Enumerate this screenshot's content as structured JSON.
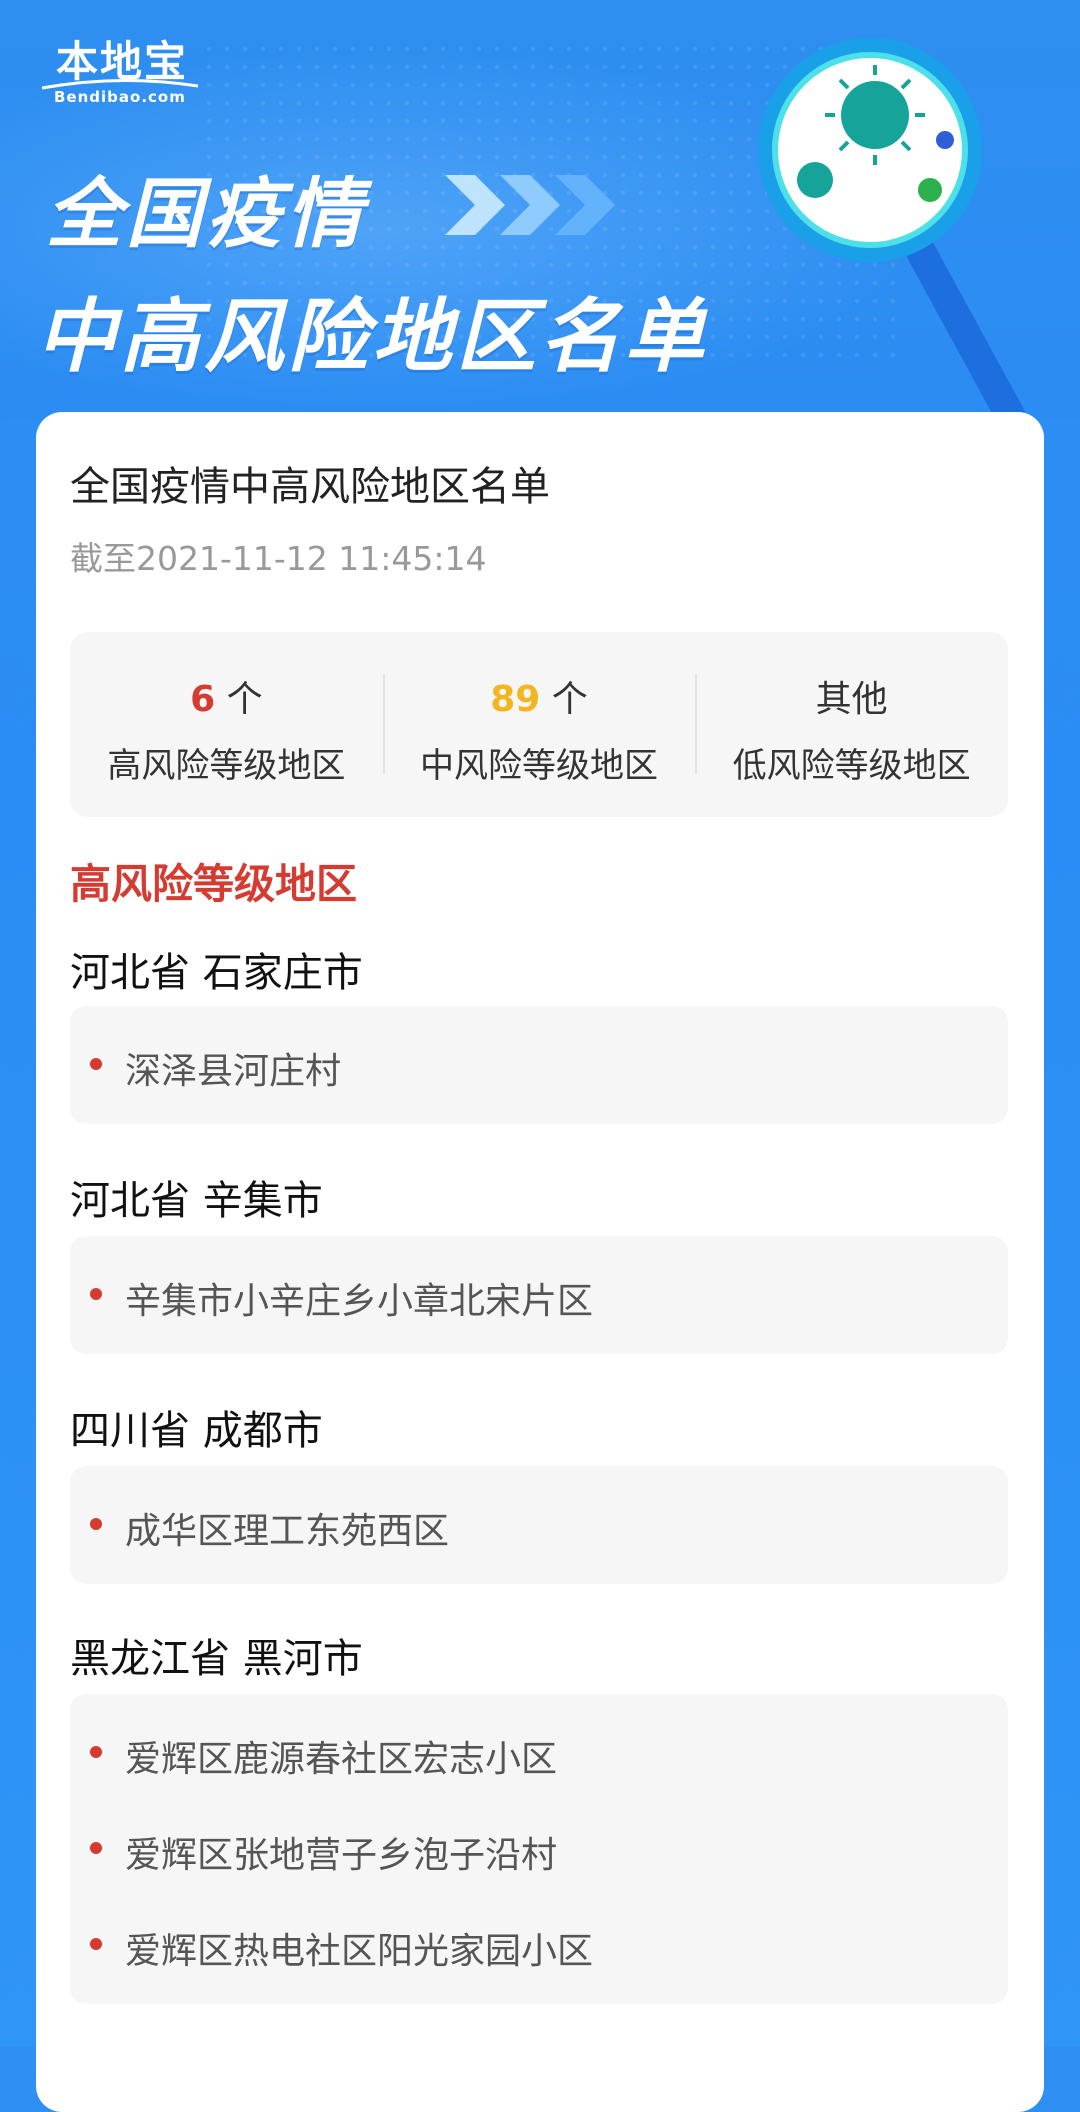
{
  "brand": {
    "name": "本地宝",
    "domain": "Bendibao.com"
  },
  "banner": {
    "line1": "全国疫情",
    "line2": "中高风险地区名单"
  },
  "card": {
    "title": "全国疫情中高风险地区名单",
    "updated": "截至2021-11-12 11:45:14"
  },
  "stats": {
    "high": {
      "count": "6",
      "unit": "个",
      "label": "高风险等级地区"
    },
    "medium": {
      "count": "89",
      "unit": "个",
      "label": "中风险等级地区"
    },
    "low": {
      "value": "其他",
      "label": "低风险等级地区"
    }
  },
  "section": {
    "heading": "高风险等级地区"
  },
  "groups": [
    {
      "title": "河北省 石家庄市",
      "items": [
        "深泽县河庄村"
      ]
    },
    {
      "title": "河北省 辛集市",
      "items": [
        "辛集市小辛庄乡小章北宋片区"
      ]
    },
    {
      "title": "四川省 成都市",
      "items": [
        "成华区理工东苑西区"
      ]
    },
    {
      "title": "黑龙江省 黑河市",
      "items": [
        "爱辉区鹿源春社区宏志小区",
        "爱辉区张地营子乡泡子沿村",
        "爱辉区热电社区阳光家园小区"
      ]
    }
  ],
  "colors": {
    "high": "#d63b32",
    "medium": "#f3b623",
    "banner": "#2b8cf3"
  }
}
